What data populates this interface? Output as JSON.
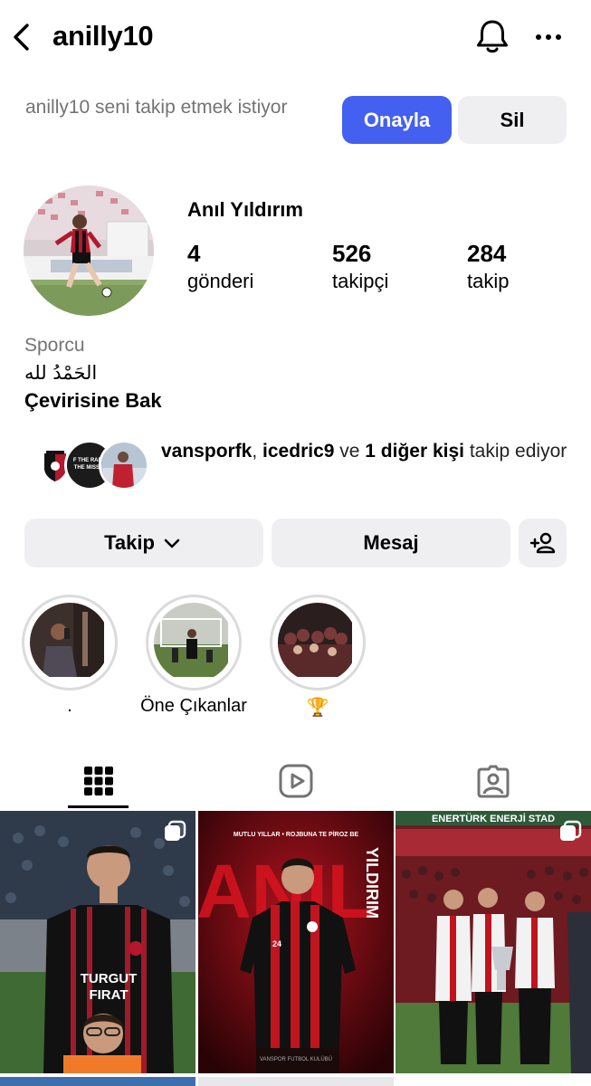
{
  "header": {
    "username": "anilly10",
    "back_icon": "chevron-left-icon",
    "notifications_icon": "bell-icon",
    "more_icon": "more-horizontal-icon"
  },
  "follow_request": {
    "text": "anilly10 seni takip etmek istiyor",
    "confirm_label": "Onayla",
    "delete_label": "Sil",
    "confirm_color": "#4460f1"
  },
  "profile": {
    "full_name": "Anıl Yıldırım",
    "stats": [
      {
        "value": "4",
        "label": "gönderi"
      },
      {
        "value": "526",
        "label": "takipçi"
      },
      {
        "value": "284",
        "label": "takip"
      }
    ],
    "category": "Sporcu",
    "bio": "الحَمْدُ لله",
    "translate_label": "Çevirisine Bak"
  },
  "mutual_followers": {
    "user1": "vansporfk",
    "sep": ", ",
    "user2": "icedric9",
    "conj": " ve ",
    "others": "1 diğer kişi",
    "suffix": " takip ediyor",
    "avatar2_text": "F THE RADAR, THE MISSION."
  },
  "actions": {
    "follow_label": "Takip",
    "message_label": "Mesaj",
    "add_user_icon": "add-user-icon"
  },
  "highlights": [
    {
      "caption": "."
    },
    {
      "caption": "Öne Çıkanlar"
    },
    {
      "caption": "🏆"
    }
  ],
  "tabs": {
    "grid_icon": "grid-icon",
    "reels_icon": "reels-icon",
    "tagged_icon": "tagged-icon"
  },
  "posts": [
    {
      "jersey_text1": "TURGUT",
      "jersey_text2": "FIRAT"
    },
    {
      "top_text": "MUTLU YILLAR • ROJBUNA TE PİROZ BE",
      "big_text": "ANIL",
      "side_text": "YILDIRIM",
      "number": "24",
      "bottom_text": "VANSPOR FUTBOL KULÜBÜ"
    },
    {
      "banner_text": "ENERTÜRK ENERJİ STAD"
    }
  ]
}
